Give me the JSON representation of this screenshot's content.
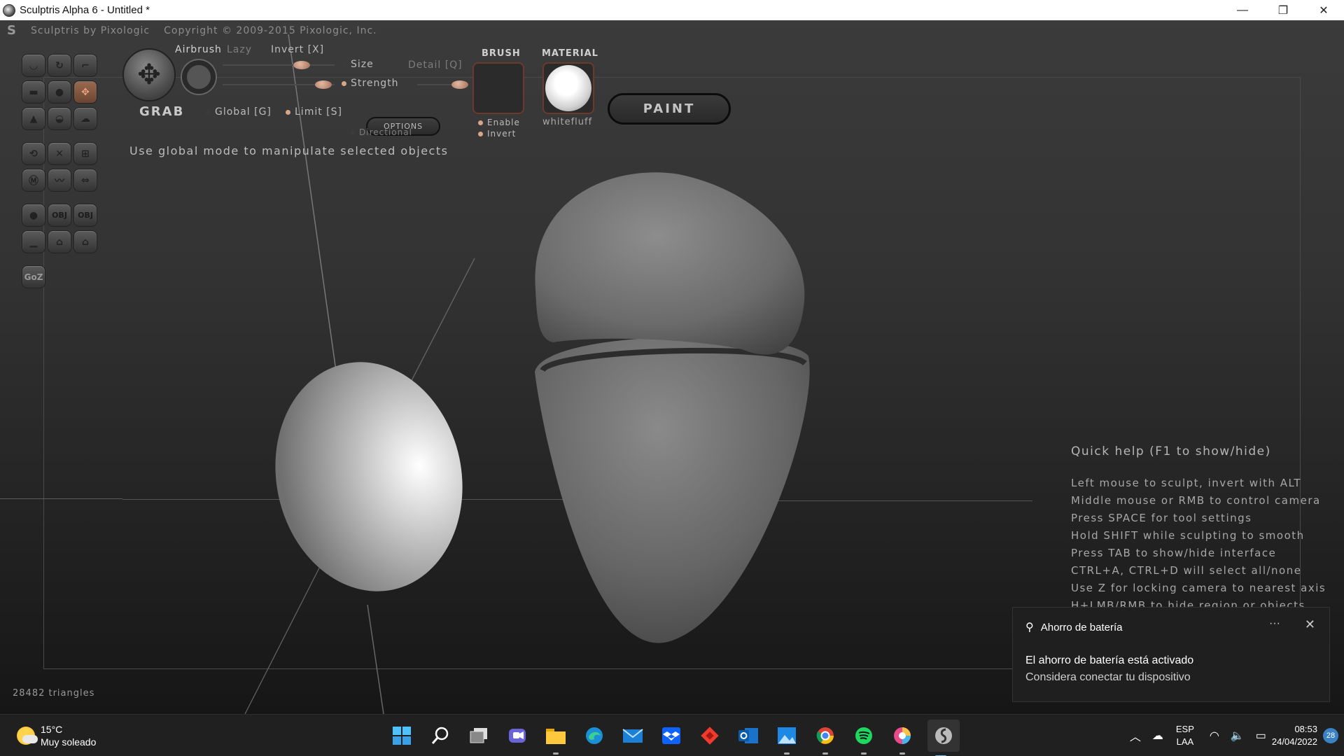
{
  "window": {
    "title": "Sculptris Alpha 6 - Untitled *",
    "minimize": "—",
    "restore": "❐",
    "close": "✕"
  },
  "header": {
    "brand": "Sculptris by Pixologic",
    "copyright": "Copyright © 2009-2015 Pixologic, Inc."
  },
  "tool": {
    "name": "GRAB",
    "airbrush": "Airbrush",
    "lazy": "Lazy",
    "invert": "Invert [X]",
    "size": "Size",
    "detail": "Detail [Q]",
    "strength": "Strength",
    "global": "Global [G]",
    "limit": "Limit [S]",
    "options": "OPTIONS",
    "directional": "Directional",
    "hint": "Use global mode to manipulate selected objects"
  },
  "brush": {
    "label": "BRUSH",
    "enable": "Enable",
    "invert": "Invert"
  },
  "material": {
    "label": "MATERIAL",
    "name": "whitefluff"
  },
  "paint_button": "PAINT",
  "goz": "GoZ",
  "triangles": "28482 triangles",
  "quick_help": {
    "title": "Quick help (F1 to show/hide)",
    "lines": [
      "Left mouse to sculpt, invert with ALT",
      "Middle mouse or RMB to control camera",
      "Press SPACE for tool settings",
      "Hold SHIFT while sculpting to smooth",
      "Press TAB to show/hide interface",
      "CTRL+A, CTRL+D will select all/none",
      "Use Z for locking camera to nearest axis",
      "H+LMB/RMB to hide region or objects"
    ]
  },
  "toast": {
    "app": "Ahorro de batería",
    "line1": "El ahorro de batería está activado",
    "line2": "Considera conectar tu dispositivo",
    "more": "···",
    "close": "✕"
  },
  "taskbar": {
    "weather_temp": "15°C",
    "weather_desc": "Muy soleado",
    "lang1": "ESP",
    "lang2": "LAA",
    "time": "08:53",
    "date": "24/04/2022",
    "badge": "28"
  }
}
